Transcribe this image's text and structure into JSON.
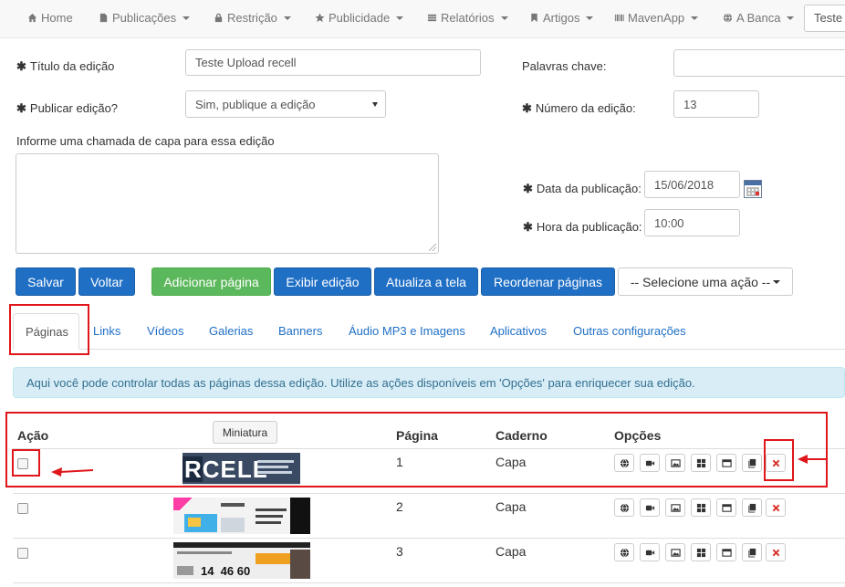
{
  "navbar": {
    "items": [
      {
        "label": "Home",
        "icon": "home-icon",
        "dropdown": false
      },
      {
        "label": "Publicações",
        "icon": "file-icon",
        "dropdown": true
      },
      {
        "label": "Restrição",
        "icon": "lock-icon",
        "dropdown": true
      },
      {
        "label": "Publicidade",
        "icon": "star-icon",
        "dropdown": true
      },
      {
        "label": "Relatórios",
        "icon": "list-icon",
        "dropdown": true
      },
      {
        "label": "Artigos",
        "icon": "bookmark-icon",
        "dropdown": true
      },
      {
        "label": "MavenApp",
        "icon": "barcode-icon",
        "dropdown": true
      },
      {
        "label": "A Banca",
        "icon": "globe-icon",
        "dropdown": true
      }
    ],
    "search_value": "Teste"
  },
  "form": {
    "title_label": "Título da edição",
    "title_value": "Teste Upload recell",
    "publish_label": "Publicar edição?",
    "publish_value": "Sim, publique a edição",
    "cover_label": "Informe uma chamada de capa para essa edição",
    "cover_value": "",
    "keywords_label": "Palavras chave:",
    "keywords_value": "",
    "number_label": "Número da edição:",
    "number_value": "13",
    "date_label": "Data da publicação:",
    "date_value": "15/06/2018",
    "time_label": "Hora da publicação:",
    "time_value": "10:00"
  },
  "actions": {
    "save": "Salvar",
    "back": "Voltar",
    "add_page": "Adicionar página",
    "show_edition": "Exibir edição",
    "refresh": "Atualiza a tela",
    "reorder": "Reordenar páginas",
    "select_action": "-- Selecione uma ação --"
  },
  "tabs": [
    "Páginas",
    "Links",
    "Vídeos",
    "Galerias",
    "Banners",
    "Áudio MP3 e Imagens",
    "Aplicativos",
    "Outras configurações"
  ],
  "alert": "Aqui você pode controlar todas as páginas dessa edição. Utilize as ações disponíveis em 'Opções' para enriquecer sua edição.",
  "table": {
    "headers": {
      "action": "Ação",
      "thumbnail": "Miniatura",
      "page": "Página",
      "section": "Caderno",
      "options": "Opções"
    },
    "rows": [
      {
        "page": "1",
        "section": "Capa",
        "thumb_text": "RCELL"
      },
      {
        "page": "2",
        "section": "Capa",
        "thumb_text": ""
      },
      {
        "page": "3",
        "section": "Capa",
        "thumb_text": "14  46 60"
      }
    ],
    "option_icons": [
      "globe-icon",
      "video-icon",
      "image-icon",
      "grid-icon",
      "window-icon",
      "book-icon",
      "delete-icon"
    ]
  },
  "colors": {
    "primary": "#1f6fc5",
    "success": "#5cb85c",
    "annotation": "#e0161b",
    "info_bg": "#d9edf7"
  }
}
